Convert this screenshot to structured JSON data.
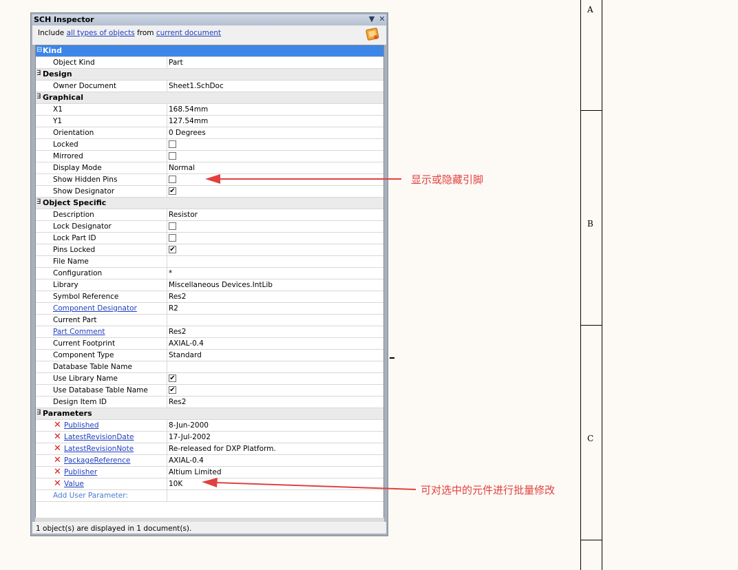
{
  "panel": {
    "title": "SCH Inspector",
    "include_prefix": "Include",
    "include_scope": "all types of objects",
    "include_from": "from",
    "include_source": "current document",
    "status": "1 object(s) are displayed in 1 document(s)."
  },
  "categories": {
    "kind": "Kind",
    "design": "Design",
    "graphical": "Graphical",
    "object_specific": "Object Specific",
    "parameters": "Parameters"
  },
  "kind": {
    "object_kind_label": "Object Kind",
    "object_kind_value": "Part"
  },
  "design": {
    "owner_label": "Owner Document",
    "owner_value": "Sheet1.SchDoc"
  },
  "graphical": {
    "x1_label": "X1",
    "x1_value": "168.54mm",
    "y1_label": "Y1",
    "y1_value": "127.54mm",
    "orientation_label": "Orientation",
    "orientation_value": "0 Degrees",
    "locked_label": "Locked",
    "locked_value": false,
    "mirrored_label": "Mirrored",
    "mirrored_value": false,
    "display_mode_label": "Display Mode",
    "display_mode_value": "Normal",
    "show_hidden_pins_label": "Show Hidden Pins",
    "show_hidden_pins_value": false,
    "show_designator_label": "Show Designator",
    "show_designator_value": true
  },
  "object_specific": {
    "description_label": "Description",
    "description_value": "Resistor",
    "lock_designator_label": "Lock Designator",
    "lock_designator_value": false,
    "lock_part_id_label": "Lock Part ID",
    "lock_part_id_value": false,
    "pins_locked_label": "Pins Locked",
    "pins_locked_value": true,
    "file_name_label": "File Name",
    "file_name_value": "",
    "configuration_label": "Configuration",
    "configuration_value": "*",
    "library_label": "Library",
    "library_value": "Miscellaneous Devices.IntLib",
    "symbol_reference_label": "Symbol Reference",
    "symbol_reference_value": "Res2",
    "component_designator_label": "Component Designator",
    "component_designator_value": "R2",
    "current_part_label": "Current Part",
    "current_part_value": "",
    "part_comment_label": "Part Comment",
    "part_comment_value": "Res2",
    "current_footprint_label": "Current Footprint",
    "current_footprint_value": "AXIAL-0.4",
    "component_type_label": "Component Type",
    "component_type_value": "Standard",
    "database_table_name_label": "Database Table Name",
    "database_table_name_value": "",
    "use_library_name_label": "Use Library Name",
    "use_library_name_value": true,
    "use_database_table_name_label": "Use Database Table Name",
    "use_database_table_name_value": true,
    "design_item_id_label": "Design Item ID",
    "design_item_id_value": "Res2"
  },
  "parameters": {
    "published_label": "Published",
    "published_value": "8-Jun-2000",
    "latest_revision_date_label": "LatestRevisionDate",
    "latest_revision_date_value": "17-Jul-2002",
    "latest_revision_note_label": "LatestRevisionNote",
    "latest_revision_note_value": "Re-released for DXP Platform.",
    "package_reference_label": "PackageReference",
    "package_reference_value": "AXIAL-0.4",
    "publisher_label": "Publisher",
    "publisher_value": "Altium Limited",
    "value_label": "Value",
    "value_value": "10K",
    "add_user_parameter": "Add User Parameter:"
  },
  "annotations": {
    "hidden_pins_note": "显示或隐藏引脚",
    "batch_edit_note": "可对选中的元件进行批量修改"
  },
  "sheet_zones": [
    "A",
    "B",
    "C"
  ],
  "colors": {
    "annotation": "#e24040",
    "kind_header": "#3d86e8",
    "link": "#1f3fbf"
  }
}
